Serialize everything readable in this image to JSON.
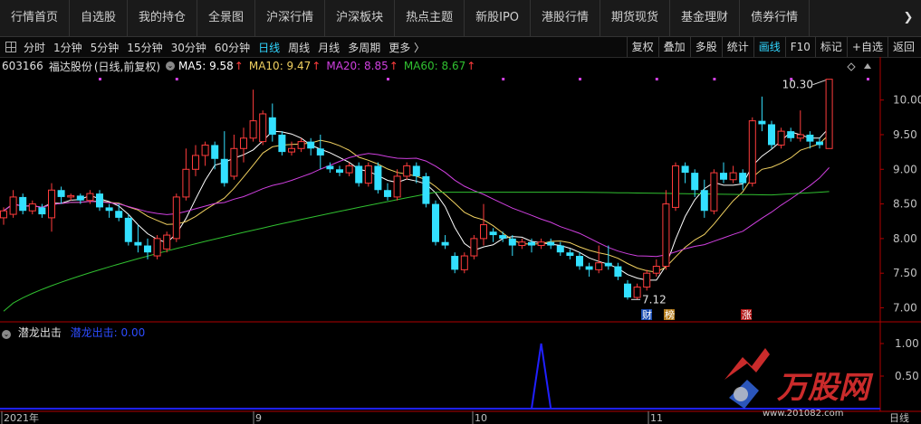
{
  "nav": {
    "tabs": [
      "行情首页",
      "自选股",
      "我的持仓",
      "全景图",
      "沪深行情",
      "沪深板块",
      "热点主题",
      "新股IPO",
      "港股行情",
      "期货现货",
      "基金理财",
      "债券行情"
    ],
    "more": "❯"
  },
  "toolbar": {
    "periods": [
      "分时",
      "1分钟",
      "5分钟",
      "15分钟",
      "30分钟",
      "60分钟",
      "日线",
      "周线",
      "月线",
      "多周期",
      "更多 〉"
    ],
    "active_period": "日线",
    "right_buttons": [
      "复权",
      "叠加",
      "多股",
      "统计",
      "画线",
      "F10",
      "标记",
      "+自选",
      "返回"
    ],
    "active_right": "画线"
  },
  "stock": {
    "code": "603166",
    "name": "福达股份",
    "mode": "(日线,前复权)",
    "ma5": "MA5: 9.58",
    "ma10": "MA10: 9.47",
    "ma20": "MA20: 8.85",
    "ma60": "MA60: 8.67"
  },
  "indicator": {
    "name": "潜龙出击",
    "value_label": "潜龙出击: 0.00"
  },
  "annotations": {
    "high_label": "10.30",
    "low_label": "7.12",
    "badge_cai": "财",
    "badge_bang": "榜",
    "badge_zhang": "涨"
  },
  "colors": {
    "up": "#ff3c3c",
    "down": "#33e0ff",
    "ma5": "#ffffff",
    "ma10": "#f0d060",
    "ma20": "#d040e0",
    "ma60": "#30c030",
    "axis": "#b00000",
    "indicator": "#2020ff"
  },
  "chart_data": {
    "type": "candlestick",
    "price_axis": {
      "ticks": [
        "10.00",
        "9.50",
        "9.00",
        "8.50",
        "8.00",
        "7.50",
        "7.00"
      ]
    },
    "indicator_axis": {
      "ticks": [
        "1.00",
        "0.50"
      ]
    },
    "x_labels": [
      "2021年",
      "9",
      "10",
      "11"
    ],
    "axis_caption": "日线",
    "candles": [
      [
        8.3,
        8.4,
        8.2,
        8.45
      ],
      [
        8.35,
        8.6,
        8.3,
        8.7
      ],
      [
        8.6,
        8.4,
        8.35,
        8.65
      ],
      [
        8.4,
        8.5,
        8.35,
        8.55
      ],
      [
        8.45,
        8.35,
        8.3,
        8.5
      ],
      [
        8.3,
        8.7,
        8.1,
        8.8
      ],
      [
        8.7,
        8.6,
        8.5,
        8.75
      ],
      [
        8.6,
        8.62,
        8.55,
        8.65
      ],
      [
        8.62,
        8.55,
        8.5,
        8.65
      ],
      [
        8.55,
        8.65,
        8.5,
        8.7
      ],
      [
        8.65,
        8.45,
        8.4,
        8.7
      ],
      [
        8.45,
        8.4,
        8.3,
        8.5
      ],
      [
        8.4,
        8.3,
        8.25,
        8.5
      ],
      [
        8.3,
        7.95,
        7.9,
        8.35
      ],
      [
        7.95,
        7.9,
        7.8,
        8.2
      ],
      [
        7.9,
        7.8,
        7.7,
        8.0
      ],
      [
        7.75,
        8.0,
        7.7,
        8.05
      ],
      [
        7.85,
        8.05,
        7.8,
        8.1
      ],
      [
        8.0,
        8.6,
        7.95,
        8.65
      ],
      [
        8.6,
        9.0,
        8.55,
        9.3
      ],
      [
        9.0,
        9.2,
        8.9,
        9.35
      ],
      [
        9.2,
        9.35,
        9.05,
        9.4
      ],
      [
        9.35,
        9.15,
        9.0,
        9.4
      ],
      [
        9.15,
        8.8,
        8.75,
        9.55
      ],
      [
        8.9,
        9.3,
        8.85,
        9.5
      ],
      [
        9.3,
        9.45,
        9.1,
        9.6
      ],
      [
        9.45,
        9.7,
        9.4,
        10.15
      ],
      [
        9.4,
        9.8,
        9.35,
        9.85
      ],
      [
        9.75,
        9.5,
        9.4,
        9.95
      ],
      [
        9.5,
        9.25,
        9.2,
        9.55
      ],
      [
        9.25,
        9.3,
        9.2,
        9.4
      ],
      [
        9.3,
        9.4,
        9.25,
        9.45
      ],
      [
        9.4,
        9.3,
        9.2,
        9.45
      ],
      [
        9.3,
        9.2,
        9.0,
        9.5
      ],
      [
        9.05,
        9.0,
        8.95,
        9.1
      ],
      [
        9.0,
        8.95,
        8.9,
        9.05
      ],
      [
        8.95,
        9.05,
        8.9,
        9.1
      ],
      [
        9.05,
        8.8,
        8.75,
        9.1
      ],
      [
        8.8,
        9.05,
        8.75,
        9.1
      ],
      [
        9.05,
        8.7,
        8.65,
        9.1
      ],
      [
        8.7,
        8.6,
        8.55,
        8.8
      ],
      [
        8.6,
        8.9,
        8.55,
        9.0
      ],
      [
        8.9,
        9.05,
        8.85,
        9.1
      ],
      [
        9.05,
        8.9,
        8.8,
        9.1
      ],
      [
        8.9,
        8.5,
        8.45,
        8.95
      ],
      [
        8.5,
        7.95,
        7.9,
        8.55
      ],
      [
        7.95,
        7.9,
        7.85,
        8.05
      ],
      [
        7.75,
        7.55,
        7.5,
        7.8
      ],
      [
        7.55,
        7.75,
        7.5,
        7.8
      ],
      [
        7.75,
        8.0,
        7.7,
        8.05
      ],
      [
        8.0,
        8.2,
        7.9,
        8.5
      ],
      [
        8.1,
        8.05,
        7.95,
        8.15
      ],
      [
        8.05,
        8.0,
        7.95,
        8.1
      ],
      [
        8.0,
        7.9,
        7.75,
        8.05
      ],
      [
        7.9,
        7.95,
        7.85,
        8.0
      ],
      [
        7.95,
        7.9,
        7.8,
        8.0
      ],
      [
        7.9,
        7.95,
        7.85,
        8.0
      ],
      [
        7.95,
        7.9,
        7.85,
        8.0
      ],
      [
        7.9,
        7.8,
        7.75,
        7.95
      ],
      [
        7.8,
        7.75,
        7.7,
        7.85
      ],
      [
        7.75,
        7.6,
        7.55,
        7.8
      ],
      [
        7.6,
        7.55,
        7.45,
        7.65
      ],
      [
        7.55,
        7.65,
        7.5,
        7.9
      ],
      [
        7.65,
        7.6,
        7.55,
        7.9
      ],
      [
        7.6,
        7.45,
        7.4,
        7.65
      ],
      [
        7.35,
        7.15,
        7.12,
        7.4
      ],
      [
        7.15,
        7.3,
        7.12,
        7.35
      ],
      [
        7.3,
        7.5,
        7.25,
        7.55
      ],
      [
        7.5,
        7.6,
        7.45,
        7.7
      ],
      [
        7.6,
        8.5,
        7.55,
        8.7
      ],
      [
        8.45,
        9.05,
        8.4,
        9.1
      ],
      [
        9.05,
        8.95,
        8.8,
        9.1
      ],
      [
        8.95,
        8.7,
        8.6,
        9.0
      ],
      [
        8.7,
        8.4,
        8.3,
        8.85
      ],
      [
        8.4,
        8.95,
        8.35,
        9.0
      ],
      [
        8.95,
        8.85,
        8.8,
        9.1
      ],
      [
        8.85,
        8.95,
        8.8,
        9.05
      ],
      [
        8.95,
        8.8,
        8.7,
        9.0
      ],
      [
        8.8,
        9.7,
        8.75,
        9.75
      ],
      [
        9.7,
        9.65,
        9.55,
        10.05
      ],
      [
        9.65,
        9.35,
        9.3,
        9.7
      ],
      [
        9.35,
        9.55,
        9.3,
        9.6
      ],
      [
        9.55,
        9.45,
        9.4,
        9.6
      ],
      [
        9.45,
        9.5,
        9.4,
        9.85
      ],
      [
        9.5,
        9.4,
        9.3,
        9.55
      ],
      [
        9.4,
        9.35,
        9.3,
        9.45
      ],
      [
        9.3,
        10.3,
        9.3,
        10.3
      ]
    ],
    "indicator_series": {
      "name": "潜龙出击",
      "spike_at": 56,
      "peak": 1.0
    }
  }
}
